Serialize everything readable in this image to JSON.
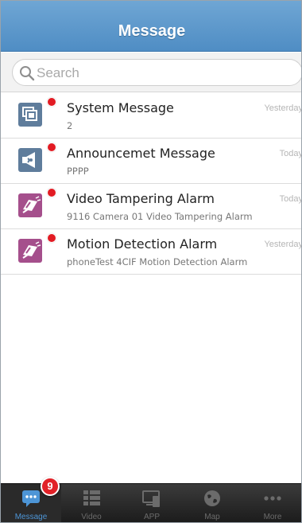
{
  "header": {
    "title": "Message"
  },
  "search": {
    "placeholder": "Search"
  },
  "messages": [
    {
      "title": "System Message",
      "subtitle": "2",
      "time": "Yesterday",
      "icon": "system-message-icon",
      "icon_color": "#5f7d9c"
    },
    {
      "title": "Announcemet Message",
      "subtitle": "PPPP",
      "time": "Today",
      "icon": "announcement-icon",
      "icon_color": "#5f7d9c"
    },
    {
      "title": "Video Tampering Alarm",
      "subtitle": "9116 Camera 01 Video Tampering Alarm",
      "time": "Today",
      "icon": "alarm-camera-icon",
      "icon_color": "#a54f8c"
    },
    {
      "title": "Motion Detection Alarm",
      "subtitle": "phoneTest 4CIF Motion Detection Alarm",
      "time": "Yesterday",
      "icon": "alarm-camera-icon",
      "icon_color": "#a54f8c"
    }
  ],
  "tabbar": {
    "badge": "9",
    "tabs": [
      {
        "label": "Message",
        "icon": "chat-bubble-icon",
        "active": true
      },
      {
        "label": "Video",
        "icon": "video-list-icon",
        "active": false
      },
      {
        "label": "APP",
        "icon": "app-devices-icon",
        "active": false
      },
      {
        "label": "Map",
        "icon": "globe-icon",
        "active": false
      },
      {
        "label": "More",
        "icon": "more-dots-icon",
        "active": false
      }
    ]
  },
  "colors": {
    "header": "#5a97cc",
    "accent": "#4d95d6",
    "unread_dot": "#e21b23"
  }
}
